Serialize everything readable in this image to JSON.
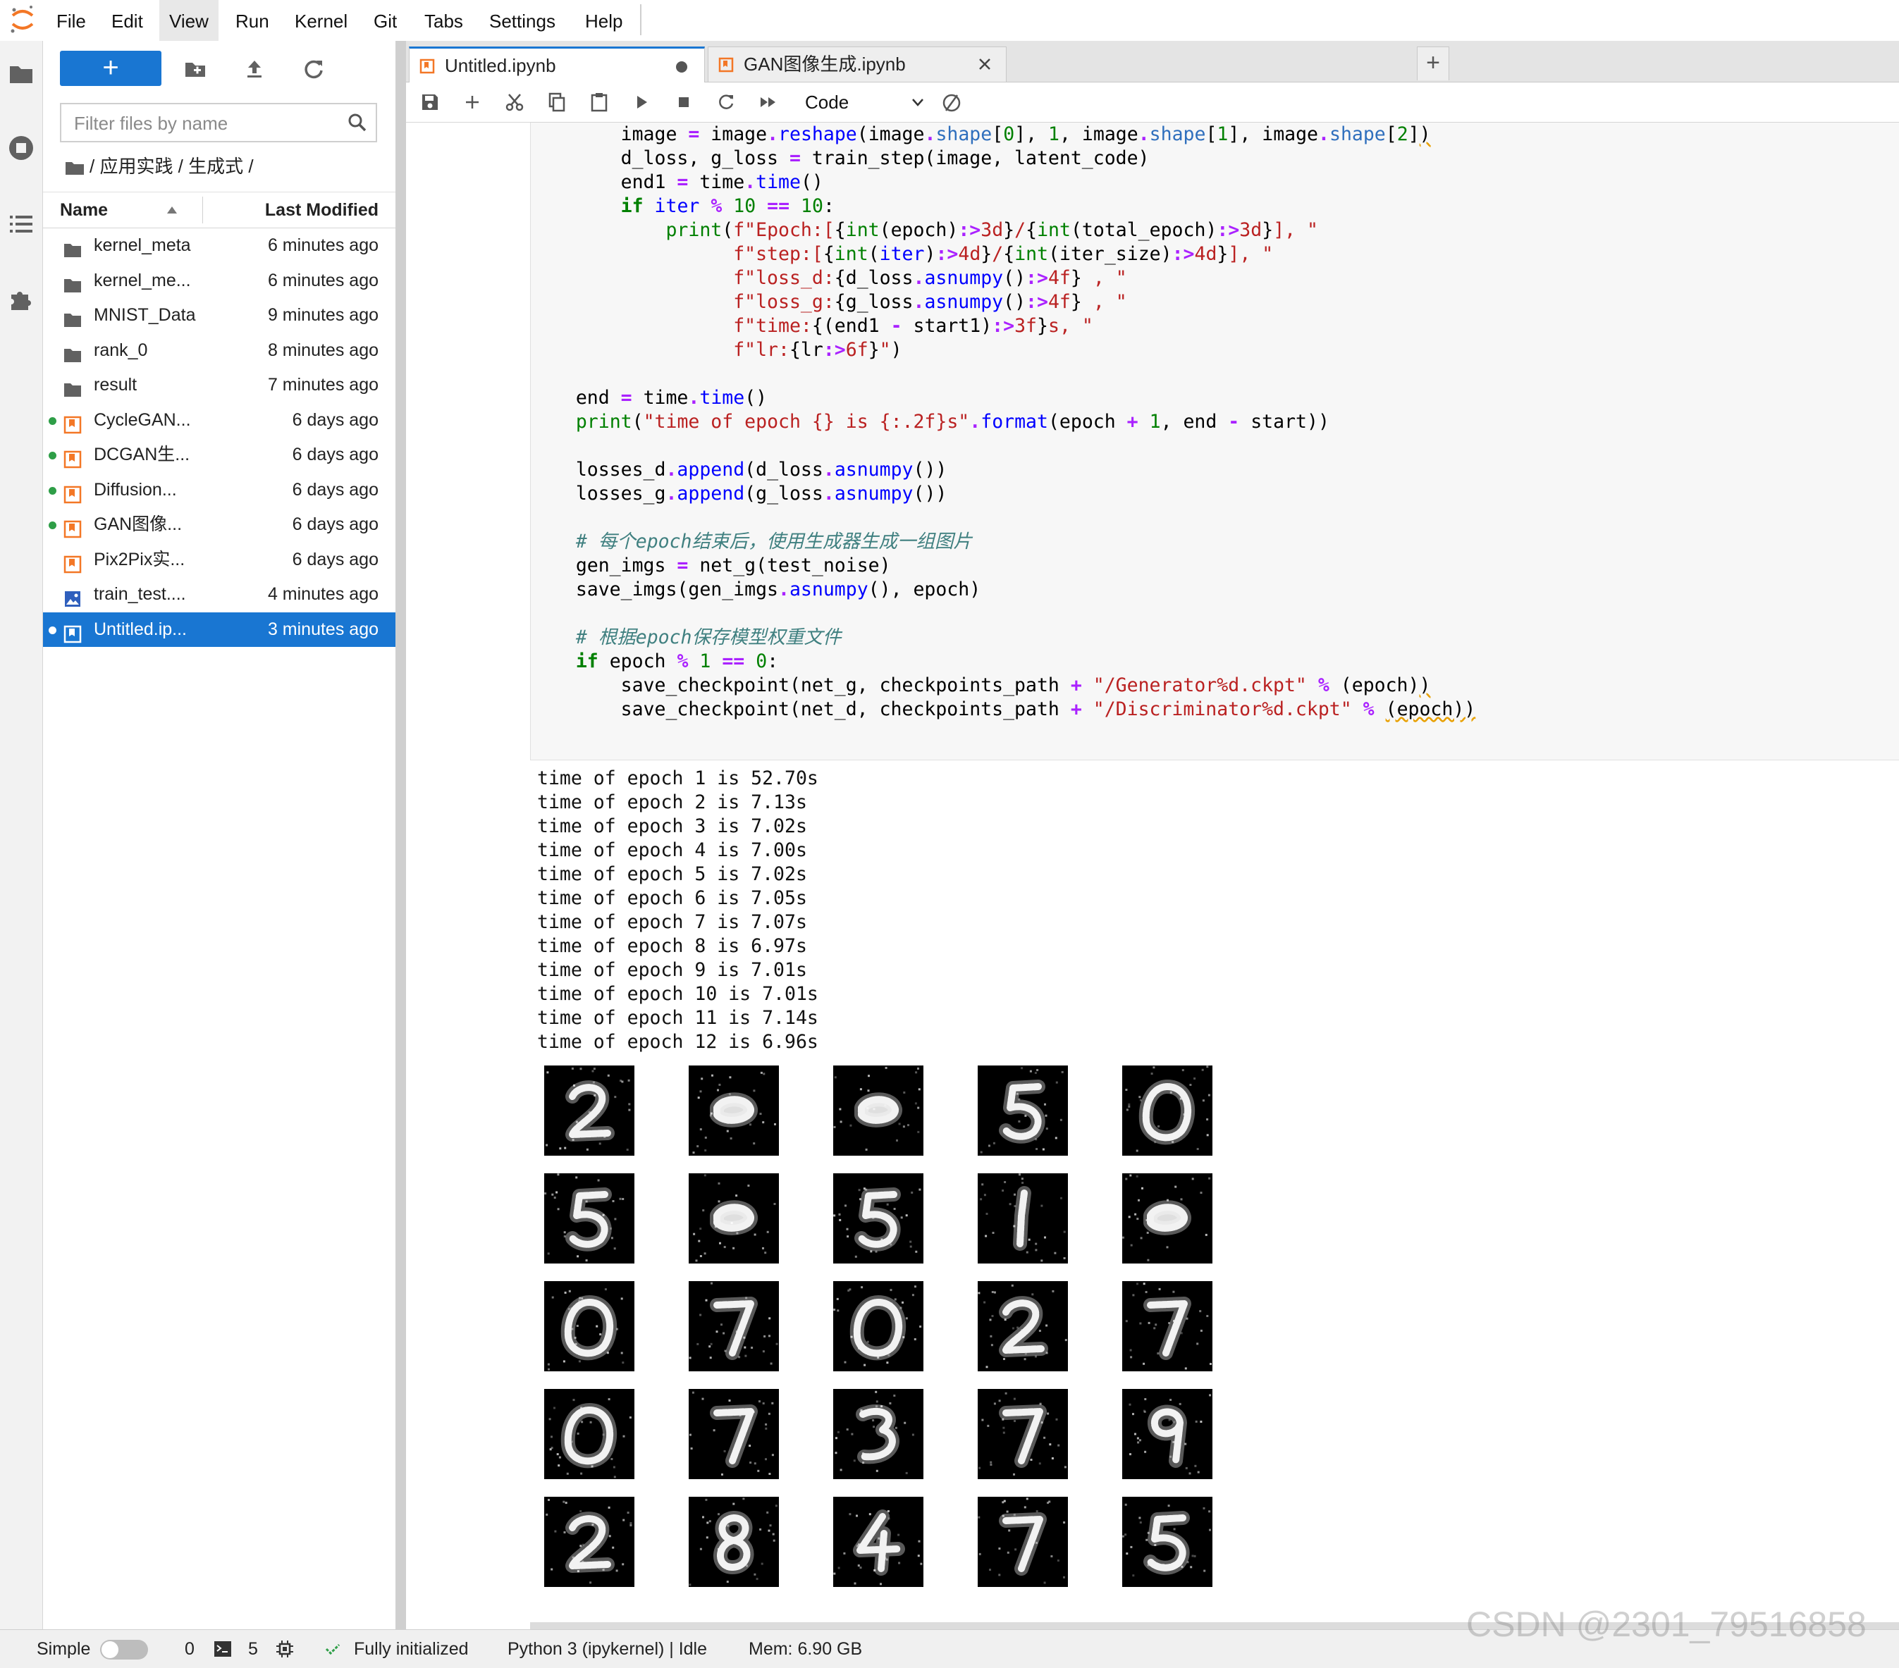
{
  "menubar": {
    "items": [
      "File",
      "Edit",
      "View",
      "Run",
      "Kernel",
      "Git",
      "Tabs",
      "Settings",
      "Help"
    ]
  },
  "filebrowser": {
    "new_label": "+",
    "filter_placeholder": "Filter files by name",
    "breadcrumb": "/ 应用实践 / 生成式 /",
    "columns": {
      "name": "Name",
      "modified": "Last Modified"
    },
    "files": [
      {
        "name": "kernel_meta",
        "modified": "6 minutes ago",
        "type": "folder",
        "running": false
      },
      {
        "name": "kernel_me...",
        "modified": "6 minutes ago",
        "type": "folder",
        "running": false
      },
      {
        "name": "MNIST_Data",
        "modified": "9 minutes ago",
        "type": "folder",
        "running": false
      },
      {
        "name": "rank_0",
        "modified": "8 minutes ago",
        "type": "folder",
        "running": false
      },
      {
        "name": "result",
        "modified": "7 minutes ago",
        "type": "folder",
        "running": false
      },
      {
        "name": "CycleGAN...",
        "modified": "6 days ago",
        "type": "notebook",
        "running": true
      },
      {
        "name": "DCGAN生...",
        "modified": "6 days ago",
        "type": "notebook",
        "running": true
      },
      {
        "name": "Diffusion...",
        "modified": "6 days ago",
        "type": "notebook",
        "running": true
      },
      {
        "name": "GAN图像...",
        "modified": "6 days ago",
        "type": "notebook",
        "running": true
      },
      {
        "name": "Pix2Pix实...",
        "modified": "6 days ago",
        "type": "notebook",
        "running": false
      },
      {
        "name": "train_test....",
        "modified": "4 minutes ago",
        "type": "image",
        "running": false
      },
      {
        "name": "Untitled.ip...",
        "modified": "3 minutes ago",
        "type": "notebook",
        "running": true,
        "selected": true
      }
    ]
  },
  "tabs": [
    {
      "label": "Untitled.ipynb",
      "active": true,
      "dirty": true
    },
    {
      "label": "GAN图像生成.ipynb",
      "active": false,
      "dirty": false
    }
  ],
  "tab_add_label": "+",
  "toolbar": {
    "cell_type": "Code"
  },
  "output": {
    "lines": [
      "time of epoch 1 is 52.70s",
      "time of epoch 2 is 7.13s",
      "time of epoch 3 is 7.02s",
      "time of epoch 4 is 7.00s",
      "time of epoch 5 is 7.02s",
      "time of epoch 6 is 7.05s",
      "time of epoch 7 is 7.07s",
      "time of epoch 8 is 6.97s",
      "time of epoch 9 is 7.01s",
      "time of epoch 10 is 7.01s",
      "time of epoch 11 is 7.14s",
      "time of epoch 12 is 6.96s"
    ],
    "generated_digits": [
      [
        "2",
        "blob",
        "blob",
        "5",
        "0"
      ],
      [
        "5",
        "blob",
        "5",
        "1",
        "blob"
      ],
      [
        "0",
        "7",
        "0",
        "2",
        "7"
      ],
      [
        "0",
        "7",
        "3",
        "7",
        "9"
      ],
      [
        "2",
        "8",
        "4",
        "7",
        "5"
      ]
    ]
  },
  "statusbar": {
    "mode_label": "Simple",
    "terminals_count": "0",
    "kernels_count": "5",
    "status": "Fully initialized",
    "kernel": "Python 3 (ipykernel) | Idle",
    "memory": "Mem: 6.90 GB"
  },
  "watermark": "CSDN @2301_79516858",
  "colors": {
    "accent": "#1976d2",
    "running_dot": "#2e9e47",
    "notebook_icon": "#f37726"
  }
}
